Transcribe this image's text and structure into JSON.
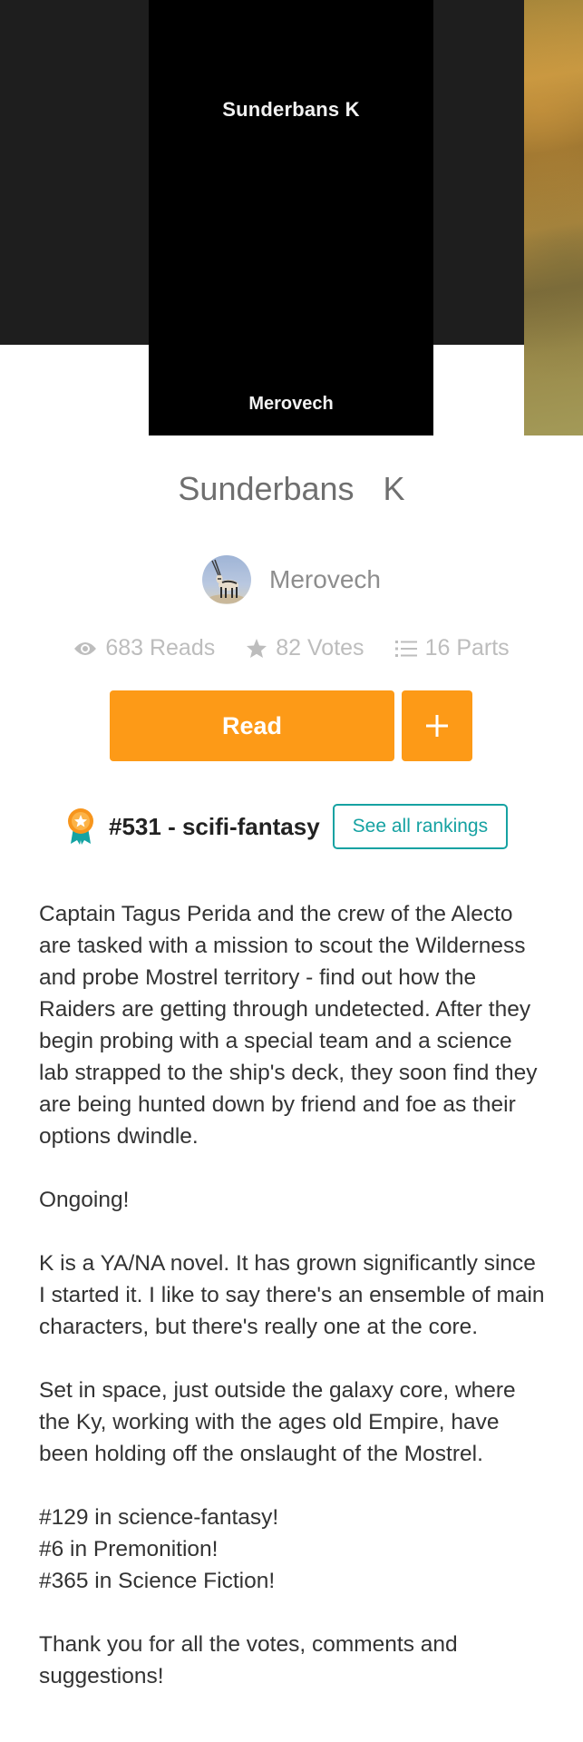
{
  "cover": {
    "title": "Sunderbans K",
    "author": "Merovech"
  },
  "story": {
    "title": "Sunderbans  K"
  },
  "author": {
    "name": "Merovech"
  },
  "stats": {
    "reads": "683 Reads",
    "votes": "82 Votes",
    "parts": "16 Parts"
  },
  "actions": {
    "read_label": "Read",
    "add_label": "+"
  },
  "ranking": {
    "label": "#531 - scifi-fantasy",
    "see_all_label": "See all rankings"
  },
  "description": {
    "paragraphs": [
      "Captain Tagus Perida and the crew of the Alecto are tasked with a mission to scout the Wilderness and probe Mostrel territory - find out how the Raiders are getting through undetected.   After they begin probing with a special team and a science lab strapped to the ship's deck, they soon find they are being hunted down by friend and foe as their options dwindle.",
      "Ongoing!",
      "K is a YA/NA novel.  It has grown significantly since I started it.  I like to say there's an ensemble of main characters, but there's really one at the core.",
      "Set in space, just outside the galaxy core, where the Ky, working with the ages old Empire, have been holding off the onslaught of the Mostrel.",
      "#129 in science-fantasy!\n#6 in Premonition!\n#365 in Science Fiction!",
      "Thank you for all the votes, comments and suggestions!"
    ]
  },
  "colors": {
    "accent_orange": "#fd9a17",
    "teal": "#16a2a2",
    "hero_dark": "#1e1e1e"
  },
  "icons": {
    "reads": "eye-icon",
    "votes": "star-icon",
    "parts": "list-icon",
    "ranking": "award-ribbon-icon",
    "add": "plus-icon"
  }
}
